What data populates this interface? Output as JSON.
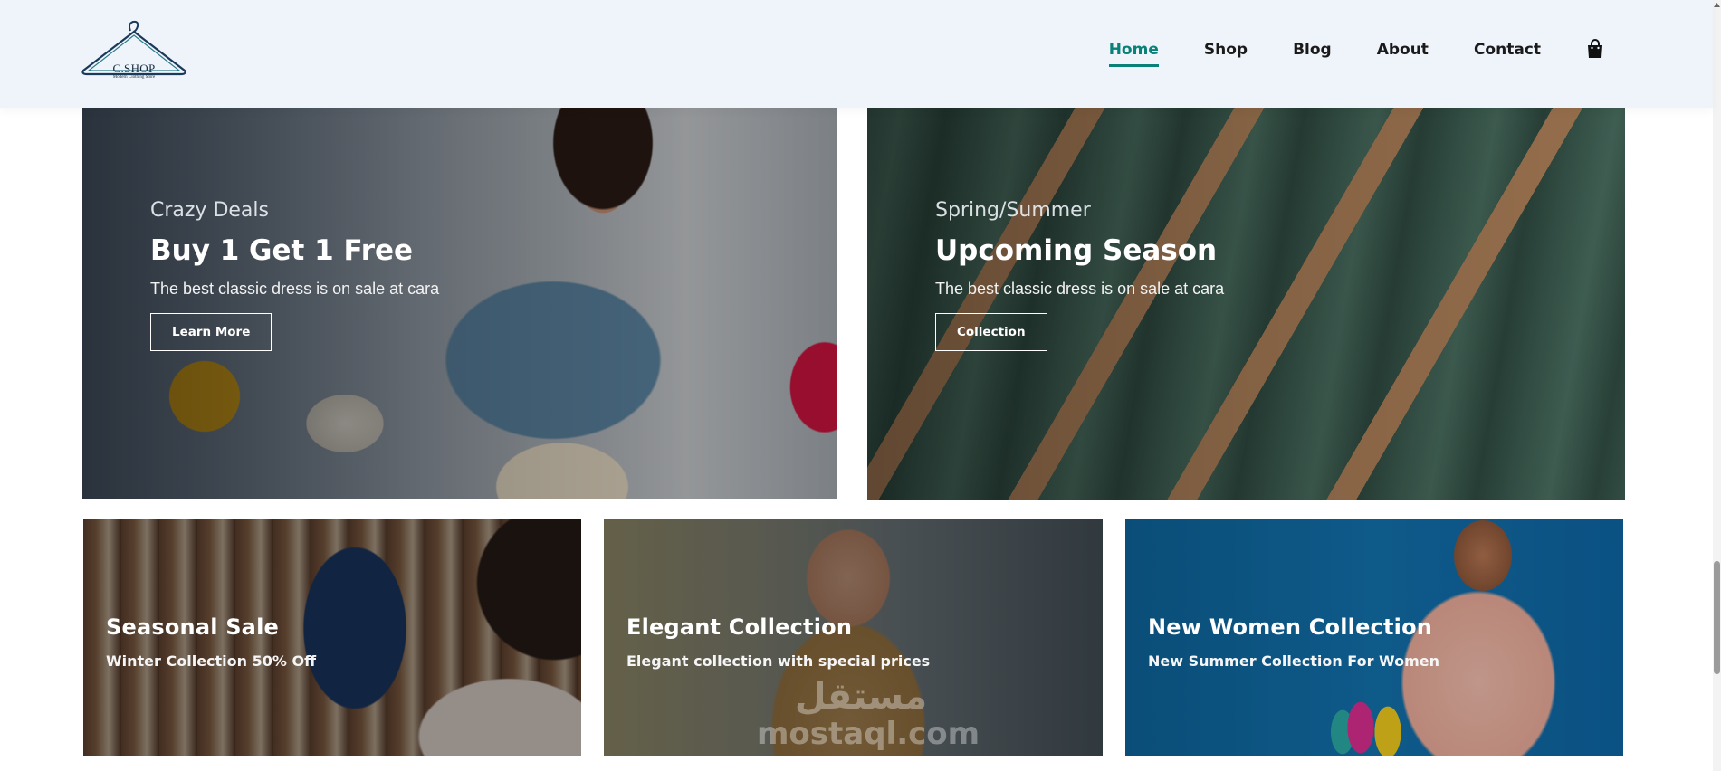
{
  "header": {
    "logo": {
      "name": "C.SHOP",
      "tagline": "Modern Clothing Store"
    },
    "nav": [
      {
        "label": "Home",
        "active": true
      },
      {
        "label": "Shop",
        "active": false
      },
      {
        "label": "Blog",
        "active": false
      },
      {
        "label": "About",
        "active": false
      },
      {
        "label": "Contact",
        "active": false
      }
    ],
    "cart_icon": "shopping-bag-icon"
  },
  "banners_large": [
    {
      "eyebrow": "Crazy Deals",
      "title": "Buy 1 Get 1 Free",
      "description": "The best classic dress is on sale at cara",
      "button": "Learn More",
      "image": "woman-with-shopping-bags"
    },
    {
      "eyebrow": "Spring/Summer",
      "title": "Upcoming Season",
      "description": "The best classic dress is on sale at cara",
      "button": "Collection",
      "image": "green-tshirts-on-hangers"
    }
  ],
  "banners_small": [
    {
      "title": "Seasonal Sale",
      "description": "Winter Collection 50% Off",
      "image": "clothes-rack"
    },
    {
      "title": "Elegant Collection",
      "description": "Elegant collection with special prices",
      "image": "man-in-coat"
    },
    {
      "title": "New Women Collection",
      "description": "New Summer Collection For Women",
      "image": "woman-on-blue"
    }
  ],
  "watermark": {
    "arabic": "مستقل",
    "latin": "mostaql.com"
  },
  "colors": {
    "accent": "#088178",
    "header_bg": "#eef4fa",
    "blue_banner": "#0f6fa6",
    "green_banner": "#3b5a4f"
  }
}
